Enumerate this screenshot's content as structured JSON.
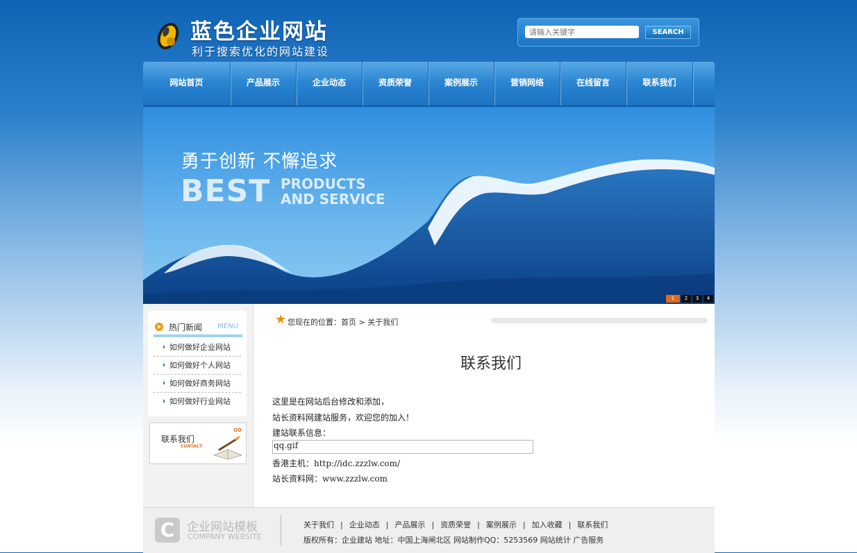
{
  "header": {
    "logo_title": "蓝色企业网站",
    "logo_subtitle": "利于搜索优化的网站建设",
    "search": {
      "placeholder": "请输入关键字",
      "button": "SEARCH"
    }
  },
  "nav": {
    "items": [
      "网站首页",
      "产品展示",
      "企业动态",
      "资质荣誉",
      "案例展示",
      "营销网络",
      "在线留言",
      "联系我们"
    ]
  },
  "banner": {
    "slogan_cn": "勇于创新 不懈追求",
    "best": "BEST",
    "products": "PRODUCTS",
    "service": "AND SERVICE",
    "slides": [
      "1",
      "2",
      "3",
      "4"
    ],
    "active_slide": 1
  },
  "sidebar": {
    "news_title": "热门新闻",
    "news_menu": "MENU",
    "news_items": [
      "如何做好企业网站",
      "如何做好个人网站",
      "如何做好商务网站",
      "如何做好行业网站"
    ],
    "contact_label": "联系我们",
    "contact_go": "GO",
    "contact_small": "CONTACT"
  },
  "main": {
    "breadcrumb": "您现在的位置：首页 > 关于我们",
    "title": "联系我们",
    "lines": [
      "这里是在网站后台修改和添加，",
      "站长资料网建站服务，欢迎您的加入！",
      "建站联系信息："
    ],
    "qq_value": "qq.gif",
    "host_line": "香港主机：http://idc.zzzlw.com/",
    "site_line": "站长资料网：www.zzzlw.com"
  },
  "footer": {
    "logo_letter": "C",
    "logo_cn": "企业网站模板",
    "logo_en": "COMPANY WEBSITE",
    "links": [
      "关于我们",
      "企业动态",
      "产品展示",
      "资质荣誉",
      "案例展示",
      "加入收藏",
      "联系我们"
    ],
    "copyright": "版权所有：企业建站 地址：中国上海闸北区 网站制作QQ：5253569 网站统计   广告服务"
  },
  "colors": {
    "brand_blue": "#1a70c0",
    "accent_orange": "#f39800",
    "link_blue": "#2f7fc7"
  }
}
